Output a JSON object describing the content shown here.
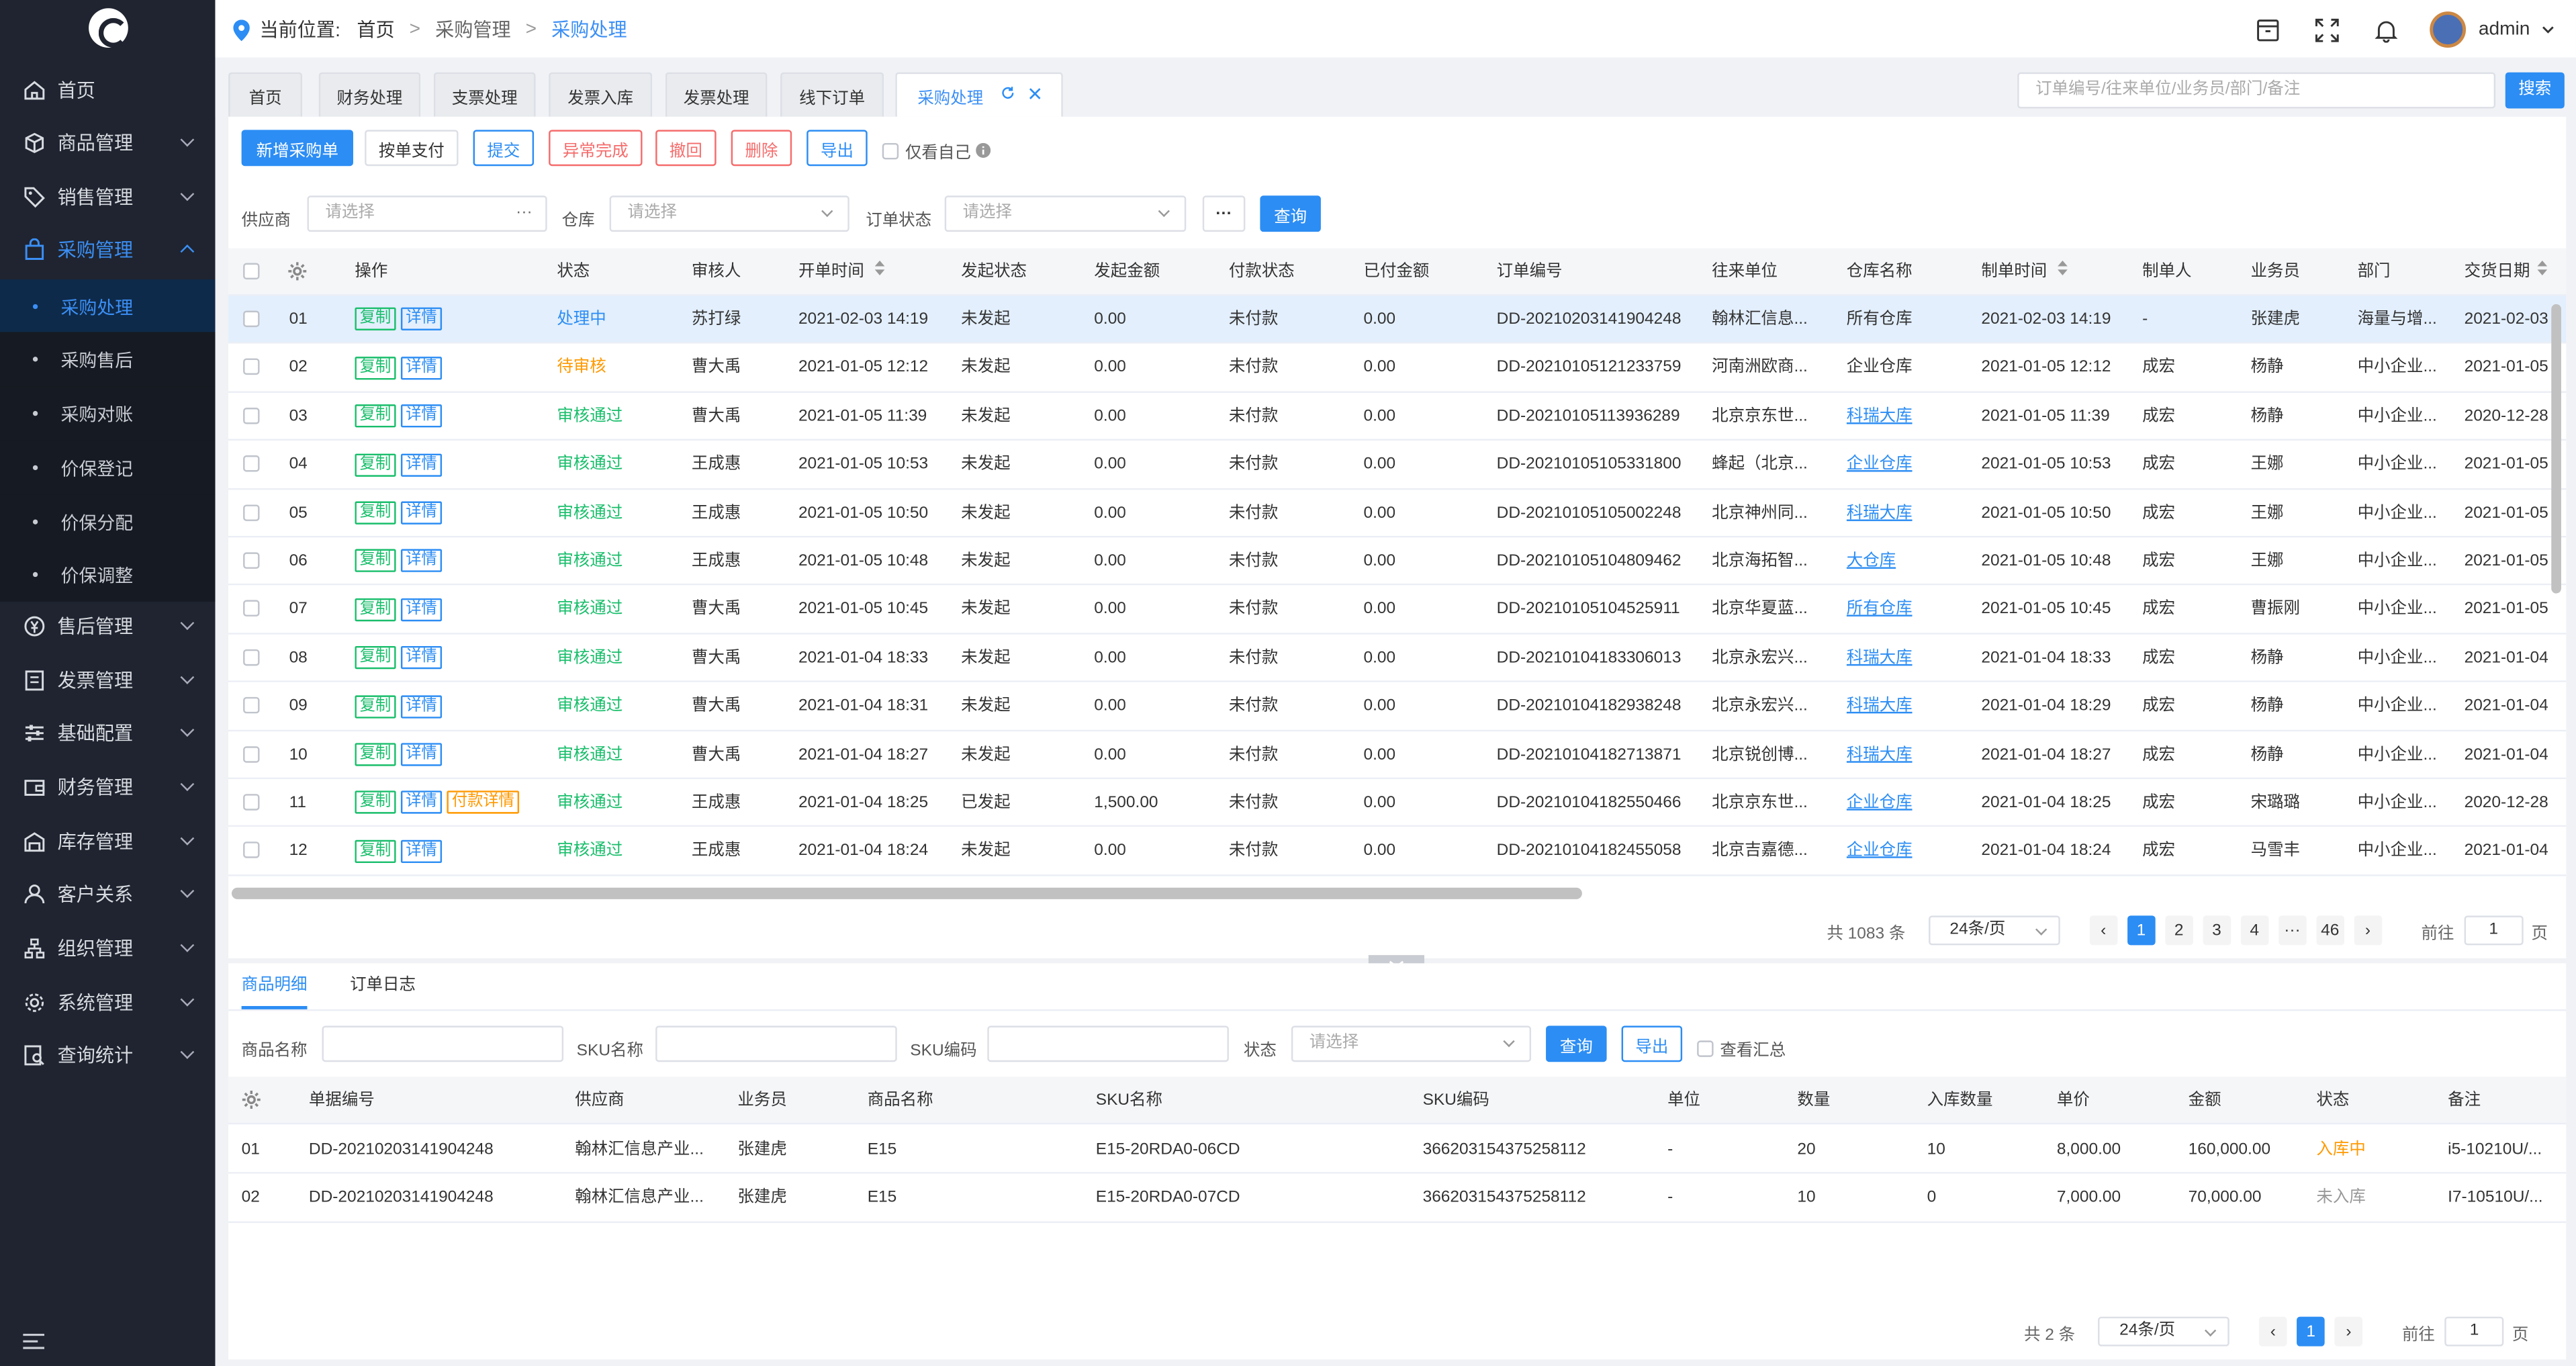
{
  "sidebar": {
    "items": [
      {
        "label": "首页",
        "icon": "home-icon"
      },
      {
        "label": "商品管理",
        "icon": "cube-icon"
      },
      {
        "label": "销售管理",
        "icon": "tag-icon"
      },
      {
        "label": "采购管理",
        "icon": "bag-icon"
      },
      {
        "label": "售后管理",
        "icon": "yen-icon"
      },
      {
        "label": "发票管理",
        "icon": "invoice-icon"
      },
      {
        "label": "基础配置",
        "icon": "sliders-icon"
      },
      {
        "label": "财务管理",
        "icon": "wallet-icon"
      },
      {
        "label": "库存管理",
        "icon": "warehouse-icon"
      },
      {
        "label": "客户关系",
        "icon": "user-icon"
      },
      {
        "label": "组织管理",
        "icon": "org-icon"
      },
      {
        "label": "系统管理",
        "icon": "gear-icon"
      },
      {
        "label": "查询统计",
        "icon": "search-doc-icon"
      }
    ],
    "sub_items": [
      "采购处理",
      "采购售后",
      "采购对账",
      "价保登记",
      "价保分配",
      "价保调整"
    ]
  },
  "topbar": {
    "location_label": "当前位置:",
    "crumbs": [
      "首页",
      "采购管理",
      "采购处理"
    ],
    "separator": ">",
    "username": "admin"
  },
  "page_tabs": [
    "首页",
    "财务处理",
    "支票处理",
    "发票入库",
    "发票处理",
    "线下订单",
    "采购处理"
  ],
  "global_search": {
    "placeholder": "订单编号/往来单位/业务员/部门/备注",
    "button": "搜索"
  },
  "toolbar": {
    "buttons": [
      "新增采购单",
      "按单支付",
      "提交",
      "异常完成",
      "撤回",
      "删除",
      "导出"
    ],
    "only_mine": "仅看自己"
  },
  "filters": {
    "supplier_label": "供应商",
    "supplier_placeholder": "请选择",
    "warehouse_label": "仓库",
    "warehouse_placeholder": "请选择",
    "status_label": "订单状态",
    "status_placeholder": "请选择",
    "more": "···",
    "query": "查询"
  },
  "orders": {
    "columns": [
      "操作",
      "状态",
      "审核人",
      "开单时间",
      "发起状态",
      "发起金额",
      "付款状态",
      "已付金额",
      "订单编号",
      "往来单位",
      "仓库名称",
      "制单时间",
      "制单人",
      "业务员",
      "部门",
      "交货日期"
    ],
    "action_labels": {
      "copy": "复制",
      "detail": "详情",
      "pay_detail": "付款详情"
    },
    "rows": [
      {
        "no": "01",
        "status": "处理中",
        "status_color": "#2c8df4",
        "auditor": "苏打绿",
        "open_time": "2021-02-03 14:19",
        "init_status": "未发起",
        "init_amount": "0.00",
        "pay_status": "未付款",
        "paid": "0.00",
        "order_no": "DD-20210203141904248",
        "partner": "翰林汇信息...",
        "warehouse": "所有仓库",
        "wh_link": false,
        "make_time": "2021-02-03 14:19",
        "maker": "-",
        "salesman": "张建虎",
        "dept": "海量与增...",
        "delivery": "2021-02-03",
        "pay_detail": false
      },
      {
        "no": "02",
        "status": "待审核",
        "status_color": "#ff9900",
        "auditor": "曹大禹",
        "open_time": "2021-01-05 12:12",
        "init_status": "未发起",
        "init_amount": "0.00",
        "pay_status": "未付款",
        "paid": "0.00",
        "order_no": "DD-20210105121233759",
        "partner": "河南洲欧商...",
        "warehouse": "企业仓库",
        "wh_link": false,
        "make_time": "2021-01-05 12:12",
        "maker": "成宏",
        "salesman": "杨静",
        "dept": "中小企业...",
        "delivery": "2021-01-05",
        "pay_detail": false
      },
      {
        "no": "03",
        "status": "审核通过",
        "status_color": "#19be6b",
        "auditor": "曹大禹",
        "open_time": "2021-01-05 11:39",
        "init_status": "未发起",
        "init_amount": "0.00",
        "pay_status": "未付款",
        "paid": "0.00",
        "order_no": "DD-20210105113936289",
        "partner": "北京京东世...",
        "warehouse": "科瑞大库",
        "wh_link": true,
        "make_time": "2021-01-05 11:39",
        "maker": "成宏",
        "salesman": "杨静",
        "dept": "中小企业...",
        "delivery": "2020-12-28",
        "pay_detail": false
      },
      {
        "no": "04",
        "status": "审核通过",
        "status_color": "#19be6b",
        "auditor": "王成惠",
        "open_time": "2021-01-05 10:53",
        "init_status": "未发起",
        "init_amount": "0.00",
        "pay_status": "未付款",
        "paid": "0.00",
        "order_no": "DD-20210105105331800",
        "partner": "蜂起（北京...",
        "warehouse": "企业仓库",
        "wh_link": true,
        "make_time": "2021-01-05 10:53",
        "maker": "成宏",
        "salesman": "王娜",
        "dept": "中小企业...",
        "delivery": "2021-01-05",
        "pay_detail": false
      },
      {
        "no": "05",
        "status": "审核通过",
        "status_color": "#19be6b",
        "auditor": "王成惠",
        "open_time": "2021-01-05 10:50",
        "init_status": "未发起",
        "init_amount": "0.00",
        "pay_status": "未付款",
        "paid": "0.00",
        "order_no": "DD-20210105105002248",
        "partner": "北京神州同...",
        "warehouse": "科瑞大库",
        "wh_link": true,
        "make_time": "2021-01-05 10:50",
        "maker": "成宏",
        "salesman": "王娜",
        "dept": "中小企业...",
        "delivery": "2021-01-05",
        "pay_detail": false
      },
      {
        "no": "06",
        "status": "审核通过",
        "status_color": "#19be6b",
        "auditor": "王成惠",
        "open_time": "2021-01-05 10:48",
        "init_status": "未发起",
        "init_amount": "0.00",
        "pay_status": "未付款",
        "paid": "0.00",
        "order_no": "DD-20210105104809462",
        "partner": "北京海拓智...",
        "warehouse": "大仓库",
        "wh_link": true,
        "make_time": "2021-01-05 10:48",
        "maker": "成宏",
        "salesman": "王娜",
        "dept": "中小企业...",
        "delivery": "2021-01-05",
        "pay_detail": false
      },
      {
        "no": "07",
        "status": "审核通过",
        "status_color": "#19be6b",
        "auditor": "曹大禹",
        "open_time": "2021-01-05 10:45",
        "init_status": "未发起",
        "init_amount": "0.00",
        "pay_status": "未付款",
        "paid": "0.00",
        "order_no": "DD-20210105104525911",
        "partner": "北京华夏蓝...",
        "warehouse": "所有仓库",
        "wh_link": true,
        "make_time": "2021-01-05 10:45",
        "maker": "成宏",
        "salesman": "曹振刚",
        "dept": "中小企业...",
        "delivery": "2021-01-05",
        "pay_detail": false
      },
      {
        "no": "08",
        "status": "审核通过",
        "status_color": "#19be6b",
        "auditor": "曹大禹",
        "open_time": "2021-01-04 18:33",
        "init_status": "未发起",
        "init_amount": "0.00",
        "pay_status": "未付款",
        "paid": "0.00",
        "order_no": "DD-20210104183306013",
        "partner": "北京永宏兴...",
        "warehouse": "科瑞大库",
        "wh_link": true,
        "make_time": "2021-01-04 18:33",
        "maker": "成宏",
        "salesman": "杨静",
        "dept": "中小企业...",
        "delivery": "2021-01-04",
        "pay_detail": false
      },
      {
        "no": "09",
        "status": "审核通过",
        "status_color": "#19be6b",
        "auditor": "曹大禹",
        "open_time": "2021-01-04 18:31",
        "init_status": "未发起",
        "init_amount": "0.00",
        "pay_status": "未付款",
        "paid": "0.00",
        "order_no": "DD-20210104182938248",
        "partner": "北京永宏兴...",
        "warehouse": "科瑞大库",
        "wh_link": true,
        "make_time": "2021-01-04 18:29",
        "maker": "成宏",
        "salesman": "杨静",
        "dept": "中小企业...",
        "delivery": "2021-01-04",
        "pay_detail": false
      },
      {
        "no": "10",
        "status": "审核通过",
        "status_color": "#19be6b",
        "auditor": "曹大禹",
        "open_time": "2021-01-04 18:27",
        "init_status": "未发起",
        "init_amount": "0.00",
        "pay_status": "未付款",
        "paid": "0.00",
        "order_no": "DD-20210104182713871",
        "partner": "北京锐创博...",
        "warehouse": "科瑞大库",
        "wh_link": true,
        "make_time": "2021-01-04 18:27",
        "maker": "成宏",
        "salesman": "杨静",
        "dept": "中小企业...",
        "delivery": "2021-01-04",
        "pay_detail": false
      },
      {
        "no": "11",
        "status": "审核通过",
        "status_color": "#19be6b",
        "auditor": "王成惠",
        "open_time": "2021-01-04 18:25",
        "init_status": "已发起",
        "init_amount": "1,500.00",
        "pay_status": "未付款",
        "paid": "0.00",
        "order_no": "DD-20210104182550466",
        "partner": "北京京东世...",
        "warehouse": "企业仓库",
        "wh_link": true,
        "make_time": "2021-01-04 18:25",
        "maker": "成宏",
        "salesman": "宋璐璐",
        "dept": "中小企业...",
        "delivery": "2020-12-28",
        "pay_detail": true
      },
      {
        "no": "12",
        "status": "审核通过",
        "status_color": "#19be6b",
        "auditor": "王成惠",
        "open_time": "2021-01-04 18:24",
        "init_status": "未发起",
        "init_amount": "0.00",
        "pay_status": "未付款",
        "paid": "0.00",
        "order_no": "DD-20210104182455058",
        "partner": "北京吉嘉德...",
        "warehouse": "企业仓库",
        "wh_link": true,
        "make_time": "2021-01-04 18:24",
        "maker": "成宏",
        "salesman": "马雪丰",
        "dept": "中小企业...",
        "delivery": "2021-01-04",
        "pay_detail": false
      }
    ],
    "pagination": {
      "total": "共 1083 条",
      "page_size": "24条/页",
      "pages": [
        "1",
        "2",
        "3",
        "4",
        "···",
        "46"
      ],
      "current": "1",
      "goto_label": "前往",
      "goto_value": "1",
      "page_unit": "页"
    }
  },
  "detail": {
    "tabs": [
      "商品明细",
      "订单日志"
    ],
    "filters": {
      "product_label": "商品名称",
      "sku_name_label": "SKU名称",
      "sku_code_label": "SKU编码",
      "status_label": "状态",
      "status_placeholder": "请选择",
      "query": "查询",
      "export": "导出",
      "summary": "查看汇总"
    },
    "columns": [
      "单据编号",
      "供应商",
      "业务员",
      "商品名称",
      "SKU名称",
      "SKU编码",
      "单位",
      "数量",
      "入库数量",
      "单价",
      "金额",
      "状态",
      "备注"
    ],
    "rows": [
      {
        "no": "01",
        "doc": "DD-20210203141904248",
        "supplier": "翰林汇信息产业...",
        "salesman": "张建虎",
        "product": "E15",
        "sku_name": "E15-20RDA0-06CD",
        "sku_code": "366203154375258112",
        "unit": "-",
        "qty": "20",
        "in_qty": "10",
        "price": "8,000.00",
        "amount": "160,000.00",
        "status": "入库中",
        "status_color": "#ff9900",
        "remark": "i5-10210U/..."
      },
      {
        "no": "02",
        "doc": "DD-20210203141904248",
        "supplier": "翰林汇信息产业...",
        "salesman": "张建虎",
        "product": "E15",
        "sku_name": "E15-20RDA0-07CD",
        "sku_code": "366203154375258112",
        "unit": "-",
        "qty": "10",
        "in_qty": "0",
        "price": "7,000.00",
        "amount": "70,000.00",
        "status": "未入库",
        "status_color": "#999999",
        "remark": "I7-10510U/..."
      }
    ],
    "pagination": {
      "total": "共 2 条",
      "page_size": "24条/页",
      "current": "1",
      "goto_label": "前往",
      "goto_value": "1",
      "page_unit": "页"
    }
  }
}
